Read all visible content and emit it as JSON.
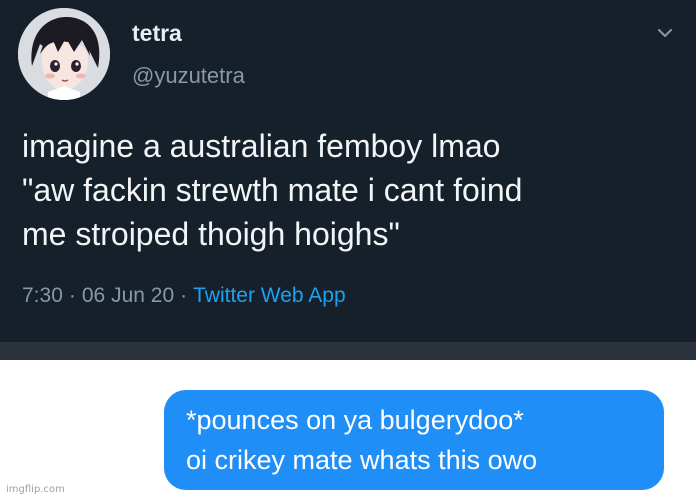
{
  "tweet": {
    "display_name": "tetra",
    "handle": "@yuzutetra",
    "text_lines": [
      "imagine a australian femboy lmao",
      "\"aw fackin strewth mate i cant foind",
      "me stroiped thoigh hoighs\""
    ],
    "time": "7:30",
    "date": "06 Jun 20",
    "separator": "·",
    "source": "Twitter Web App",
    "menu_icon": "chevron-down-icon",
    "avatar_icon": "anime-avatar"
  },
  "reply": {
    "lines": [
      "*pounces on ya bulgerydoo*",
      "oi crikey mate whats this owo"
    ]
  },
  "watermark": "imgflip.com",
  "colors": {
    "tweet_bg": "#15202b",
    "link": "#1da1f2",
    "bubble": "#1f8ef6"
  }
}
